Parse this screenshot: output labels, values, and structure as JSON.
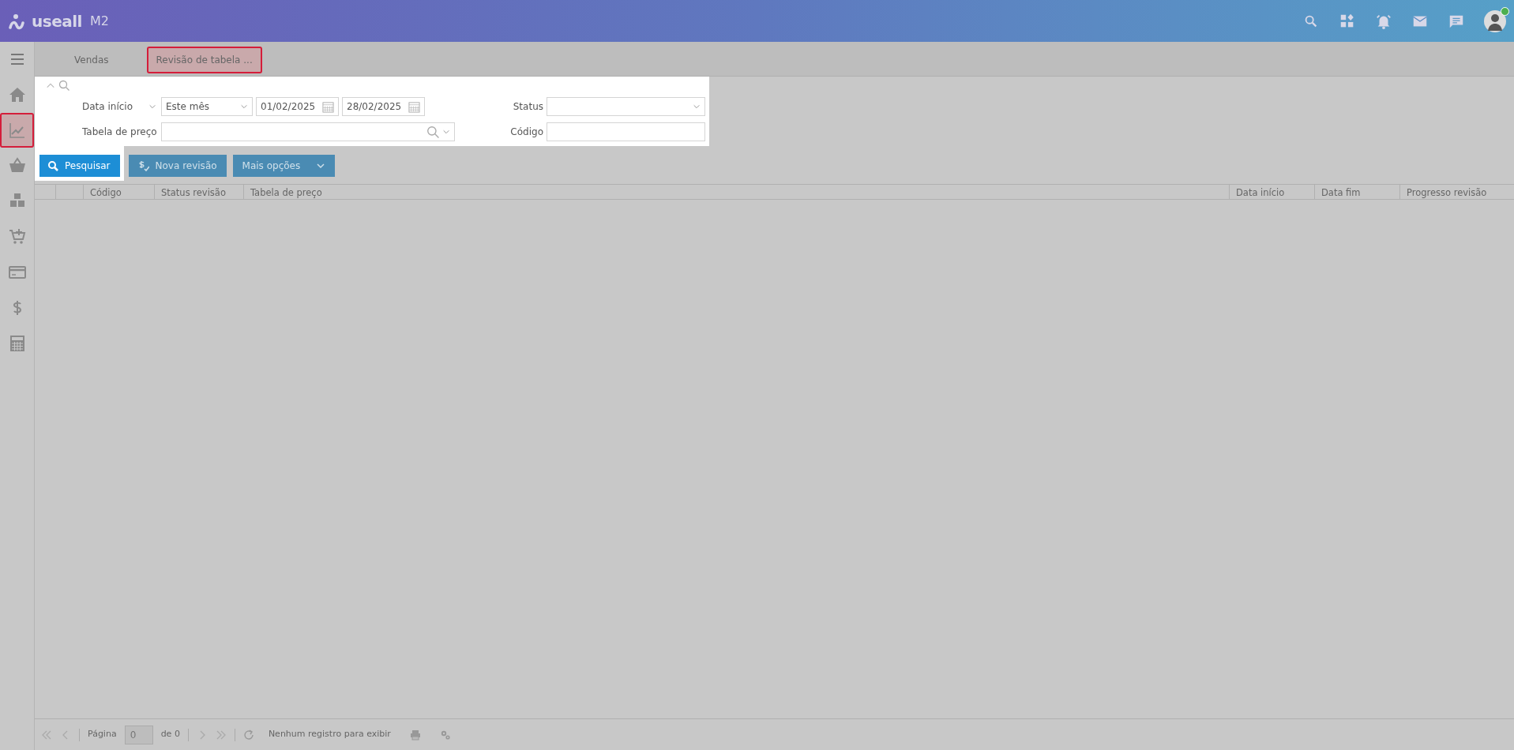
{
  "header": {
    "logo": "useall",
    "product": "M2",
    "user": {
      "online": true
    }
  },
  "sidebar": {
    "items": [
      {
        "kind": "home",
        "selected": false
      },
      {
        "kind": "chart",
        "selected": true
      },
      {
        "kind": "basket",
        "selected": false
      },
      {
        "kind": "boxes",
        "selected": false
      },
      {
        "kind": "cart",
        "selected": false
      },
      {
        "kind": "card",
        "selected": false
      },
      {
        "kind": "dollar",
        "selected": false
      },
      {
        "kind": "calculator",
        "selected": false
      }
    ]
  },
  "tabs": [
    {
      "label": "Vendas",
      "selected": false
    },
    {
      "label": "Revisão de tabela ...",
      "selected": true
    }
  ],
  "filters": {
    "date_field": "Data início",
    "period": "Este mês",
    "date_from": "01/02/2025",
    "date_to": "28/02/2025",
    "price_table_label": "Tabela de preço",
    "status_label": "Status",
    "code_label": "Código"
  },
  "buttons": [
    {
      "label": "Pesquisar",
      "kind": "primary"
    },
    {
      "label": "Nova revisão",
      "kind": "secondary"
    },
    {
      "label": "Mais opções",
      "kind": "dropdown"
    }
  ],
  "table": {
    "columns": [
      "Código",
      "Status revisão",
      "Tabela de preço",
      "Data início",
      "Data fim",
      "Progresso revisão"
    ]
  },
  "pager": {
    "page_label": "Página",
    "page_value": "0",
    "page_total": "de 0",
    "message": "Nenhum registro para exibir"
  }
}
